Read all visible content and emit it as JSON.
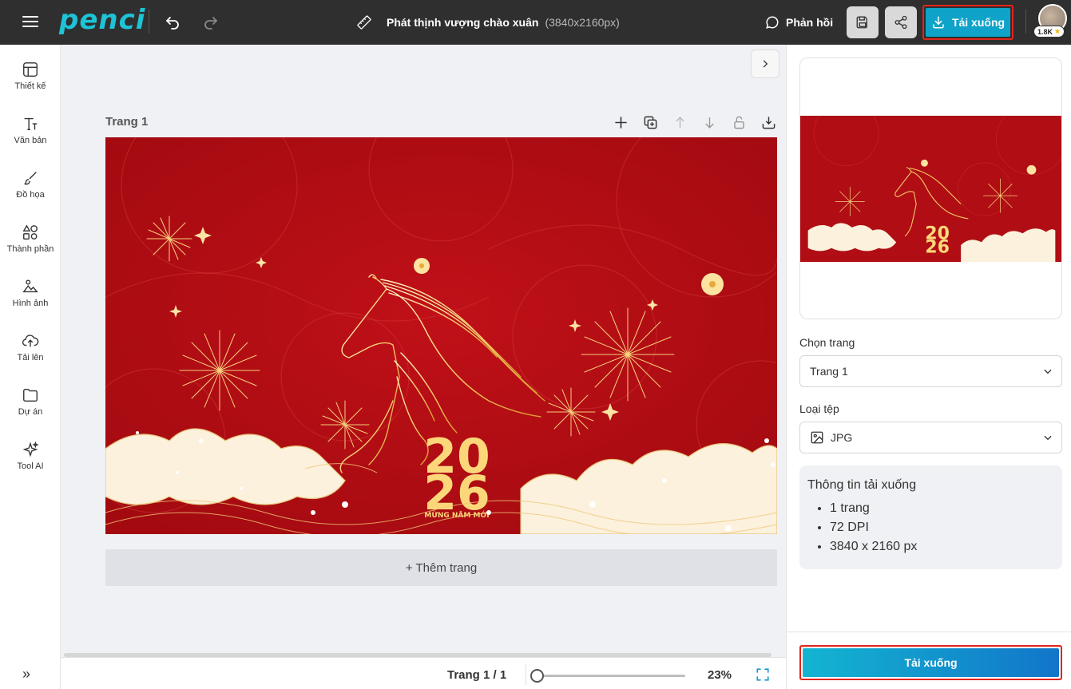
{
  "app": {
    "logo": "penci",
    "title": "Phát thịnh vượng chào xuân",
    "dimensions": "(3840x2160px)",
    "feedback_label": "Phản hồi",
    "download_label": "Tải xuống",
    "avatar_badge": "1.8K",
    "accent_color": "#0fa3c9",
    "highlight_color": "#e0241b"
  },
  "sidebar": {
    "items": [
      {
        "label": "Thiết kế",
        "icon": "layout-icon"
      },
      {
        "label": "Văn bản",
        "icon": "text-icon"
      },
      {
        "label": "Đồ họa",
        "icon": "brush-icon"
      },
      {
        "label": "Thành phần",
        "icon": "shapes-icon"
      },
      {
        "label": "Hình ảnh",
        "icon": "image-icon"
      },
      {
        "label": "Tải lên",
        "icon": "upload-icon"
      },
      {
        "label": "Dự án",
        "icon": "folder-icon"
      },
      {
        "label": "Tool AI",
        "icon": "sparkle-icon"
      }
    ],
    "expand_glyph": "»"
  },
  "canvas": {
    "page_label": "Trang 1",
    "design_year_top": "20",
    "design_year_bottom": "26",
    "design_caption": "MỪNG NĂM MỚI",
    "design_bg_color": "#b00e14",
    "add_page_label": "+ Thêm trang"
  },
  "status": {
    "page_count": "Trang 1 / 1",
    "zoom": "23%",
    "zoom_fraction": 0.0
  },
  "panel": {
    "select_page_label": "Chọn trang",
    "page_value": "Trang 1",
    "file_type_label": "Loại tệp",
    "file_type_value": "JPG",
    "info_title": "Thông tin tải xuống",
    "info_items": [
      "1 trang",
      "72 DPI",
      "3840 x 2160 px"
    ],
    "download_label": "Tải xuống"
  }
}
